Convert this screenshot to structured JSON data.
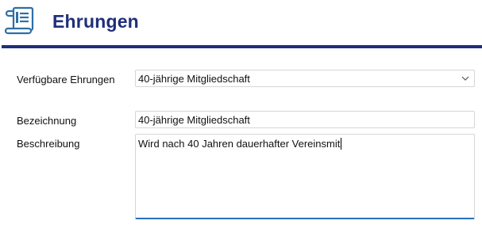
{
  "header": {
    "title": "Ehrungen",
    "icon": "scroll-list-icon",
    "accent_color": "#1f2e7a"
  },
  "form": {
    "available_label": "Verfügbare Ehrungen",
    "available_selected": "40-jährige Mitgliedschaft",
    "name_label": "Bezeichnung",
    "name_value": "40-jährige Mitgliedschaft",
    "description_label": "Beschreibung",
    "description_value": "Wird nach 40 Jahren dauerhafter Vereinsmit",
    "focus_color": "#2a6fc0"
  }
}
